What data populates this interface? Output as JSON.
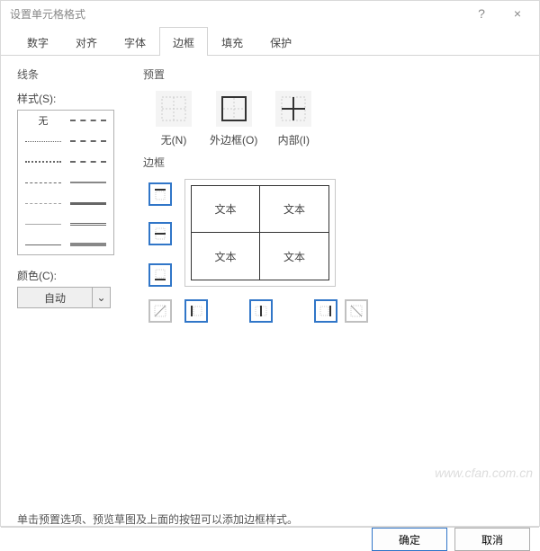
{
  "window": {
    "title": "设置单元格格式",
    "help": "?",
    "close": "×"
  },
  "tabs": {
    "items": [
      "数字",
      "对齐",
      "字体",
      "边框",
      "填充",
      "保护"
    ],
    "active_index": 3
  },
  "line_section": {
    "title": "线条",
    "style_label": "样式(S):",
    "none_label": "无"
  },
  "color": {
    "label": "颜色(C):",
    "value": "自动",
    "chevron": "⌄"
  },
  "presets": {
    "title": "预置",
    "none": "无(N)",
    "outline": "外边框(O)",
    "inside": "内部(I)"
  },
  "border": {
    "title": "边框",
    "sample_text": "文本"
  },
  "hint": "单击预置选项、预览草图及上面的按钮可以添加边框样式。",
  "footer": {
    "ok": "确定",
    "cancel": "取消"
  },
  "watermark": "www.cfan.com.cn"
}
